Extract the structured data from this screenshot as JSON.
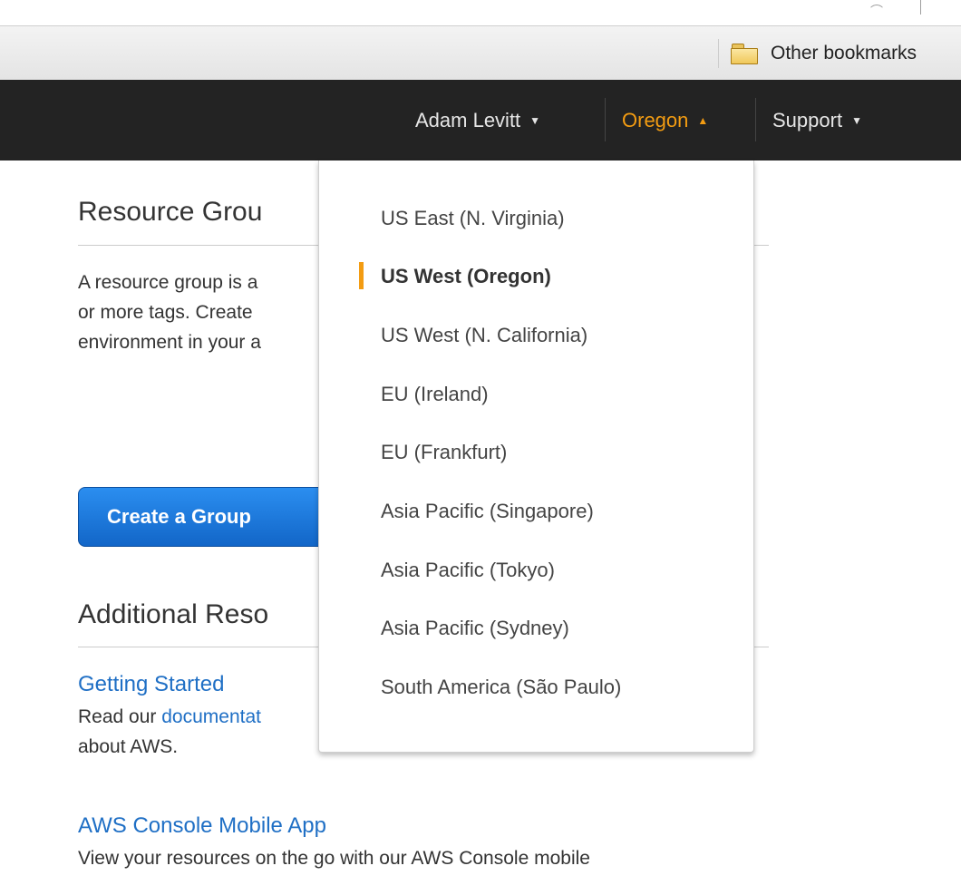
{
  "browser": {
    "bookmarks_folder_label": "Other bookmarks"
  },
  "navbar": {
    "user_label": "Adam Levitt",
    "region_label": "Oregon",
    "support_label": "Support",
    "region_color": "#f39c12"
  },
  "main": {
    "resource_groups_heading": "Resource Grou",
    "intro_line1": "A resource group is a",
    "intro_line2": "or more tags. Create",
    "intro_line3": "environment in your a",
    "create_button_label": "Create a Group",
    "additional_heading": "Additional Reso",
    "getting_started_link": "Getting Started",
    "getting_started_desc_prefix": "Read our ",
    "getting_started_desc_link": "documentat",
    "getting_started_desc_line2": "about AWS.",
    "mobile_app_link": "AWS Console Mobile App",
    "mobile_app_desc": "View your resources on the go with our AWS Console mobile"
  },
  "region_dropdown": {
    "items": [
      {
        "label": "US East (N. Virginia)",
        "selected": false
      },
      {
        "label": "US West (Oregon)",
        "selected": true
      },
      {
        "label": "US West (N. California)",
        "selected": false
      },
      {
        "label": "EU (Ireland)",
        "selected": false
      },
      {
        "label": "EU (Frankfurt)",
        "selected": false
      },
      {
        "label": "Asia Pacific (Singapore)",
        "selected": false
      },
      {
        "label": "Asia Pacific (Tokyo)",
        "selected": false
      },
      {
        "label": "Asia Pacific (Sydney)",
        "selected": false
      },
      {
        "label": "South America (São Paulo)",
        "selected": false
      }
    ]
  }
}
